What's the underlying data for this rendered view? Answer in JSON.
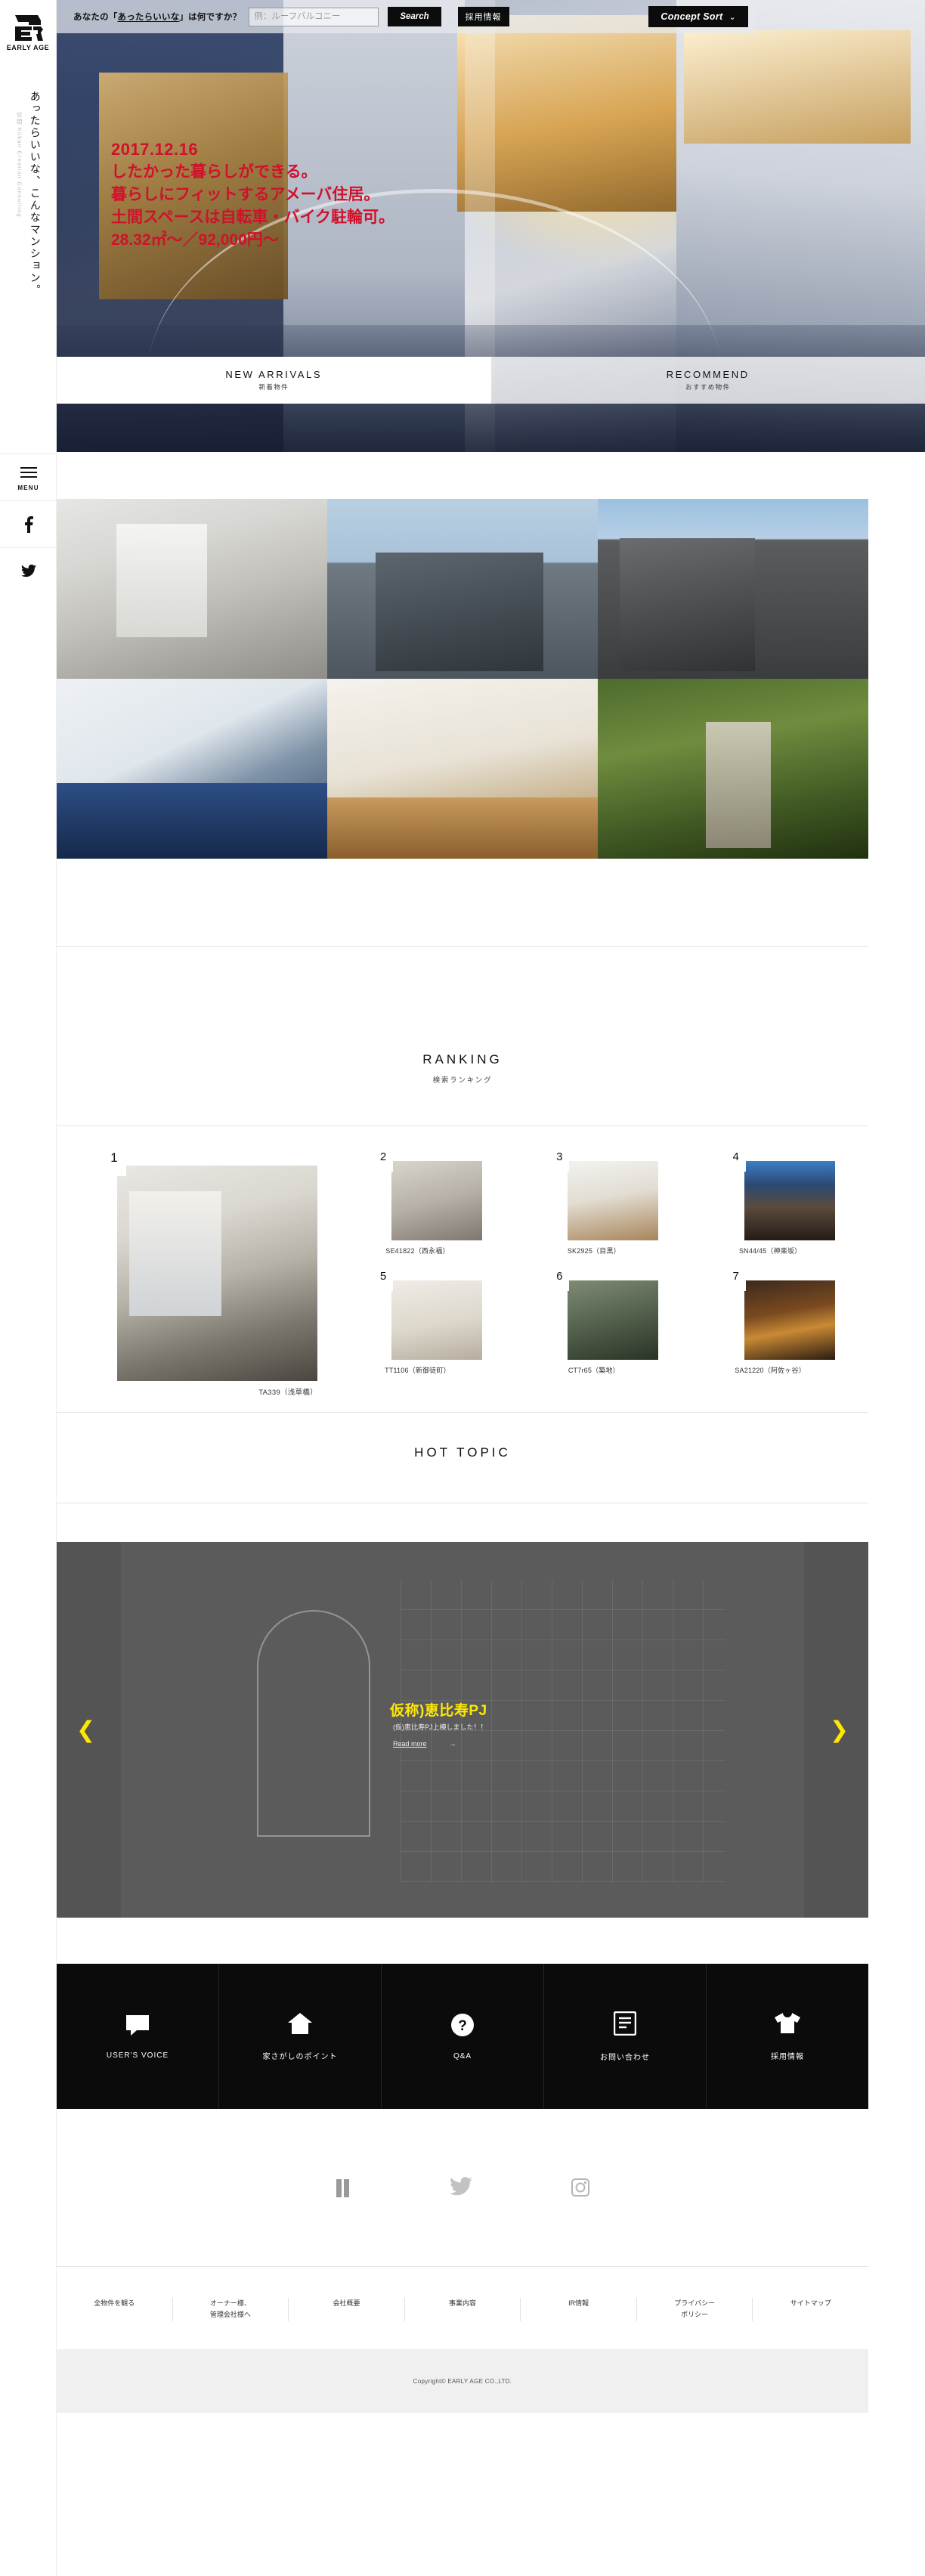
{
  "sidebar": {
    "logo_text": "EARLY AGE",
    "tagline_jp": "あったらいいな、こんなマンション。",
    "tagline_en": "空間 Kūkan Creation Consulting",
    "menu_label": "MENU",
    "facebook_icon": "facebook-icon",
    "twitter_icon": "twitter-icon"
  },
  "topbar": {
    "question": "あなたの「あったらいいな」は何ですか？",
    "search_placeholder": "例：ルーフバルコニー",
    "search_value": "",
    "search_button": "Search",
    "recruit_label": "採用情報",
    "sort_label": "Concept Sort",
    "sort_caret": "⌄"
  },
  "hero": {
    "date": "2017.12.16",
    "line1": "したかった暮らしができる。",
    "line2": "暮らしにフィットするアメーバ住居。",
    "line3": "土間スペースは自転車・バイク駐輪可。",
    "line4": "28.32㎡〜／92,000円〜"
  },
  "tabs": [
    {
      "en": "NEW ARRIVALS",
      "jp": "新着物件",
      "active": true
    },
    {
      "en": "RECOMMEND",
      "jp": "おすすめ物件",
      "active": false
    }
  ],
  "gallery": {
    "items": [
      {
        "name": "gallery-item-1"
      },
      {
        "name": "gallery-item-2"
      },
      {
        "name": "gallery-item-3"
      },
      {
        "name": "gallery-item-4"
      },
      {
        "name": "gallery-item-5"
      },
      {
        "name": "gallery-item-6"
      }
    ]
  },
  "ranking": {
    "heading_en": "RANKING",
    "heading_jp": "検索ランキング",
    "items": [
      {
        "rank": "1",
        "label": "TA339（浅草橋）"
      },
      {
        "rank": "2",
        "label": "SE41822（西永福）"
      },
      {
        "rank": "3",
        "label": "SK2925（目黒）"
      },
      {
        "rank": "4",
        "label": "SN44/45（神楽坂）"
      },
      {
        "rank": "5",
        "label": "TT1106（新御徒町）"
      },
      {
        "rank": "6",
        "label": "CT7r65（築地）"
      },
      {
        "rank": "7",
        "label": "SA21220（阿佐ヶ谷）"
      }
    ]
  },
  "hot_topic": {
    "heading_en": "HOT TOPIC",
    "slide_title": "仮称)恵比寿PJ",
    "slide_sub": "(仮)恵比寿PJ上棟しました！！",
    "read_more": "Read more",
    "read_more_arrow": "→",
    "prev_arrow": "❮",
    "next_arrow": "❯"
  },
  "icon_nav": [
    {
      "icon": "speech-bubble-icon",
      "label": "USER'S VOICE"
    },
    {
      "icon": "house-icon",
      "label": "家さがしのポイント"
    },
    {
      "icon": "question-mark-icon",
      "label": "Q&A"
    },
    {
      "icon": "document-icon",
      "label": "お問い合わせ"
    },
    {
      "icon": "tshirt-icon",
      "label": "採用情報"
    }
  ],
  "social": [
    {
      "icon": "facebook-icon"
    },
    {
      "icon": "twitter-icon"
    },
    {
      "icon": "instagram-icon"
    }
  ],
  "footer": {
    "links": [
      "全物件を観る",
      "オーナー様、\n管理会社様へ",
      "会社概要",
      "事業内容",
      "IR情報",
      "プライバシー\nポリシー",
      "サイトマップ"
    ],
    "copyright": "Copyright© EARLY AGE CO.,LTD."
  },
  "colors": {
    "accent_red": "#d0112b",
    "accent_yellow": "#ffe800",
    "black": "#0b0b0b"
  }
}
